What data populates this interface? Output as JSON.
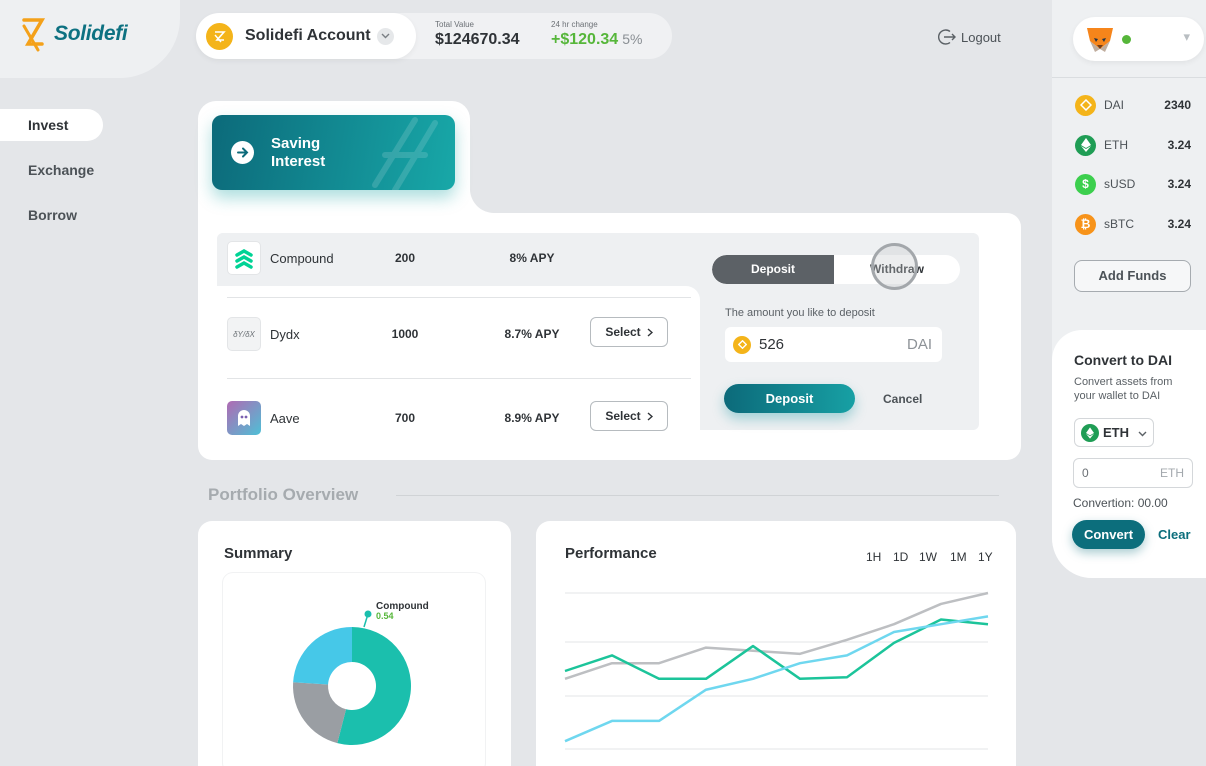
{
  "brand": {
    "name": "Solidefi"
  },
  "nav": {
    "items": [
      {
        "label": "Invest",
        "active": true
      },
      {
        "label": "Exchange",
        "active": false
      },
      {
        "label": "Borrow",
        "active": false
      }
    ]
  },
  "header": {
    "account_name": "Solidefi Account",
    "total_value_label": "Total Value",
    "total_value": "$124670.34",
    "change_label": "24 hr change",
    "change_value": "+$120.34",
    "change_pct": "5%",
    "logout_label": "Logout"
  },
  "wallet": {
    "icon": "metamask-fox-icon",
    "status_color": "#56b63a",
    "tokens": [
      {
        "name": "DAI",
        "value": "2340",
        "icon": "dai-icon",
        "color": "#f4b41a"
      },
      {
        "name": "ETH",
        "value": "3.24",
        "icon": "eth-icon",
        "color": "#1f9d55"
      },
      {
        "name": "sUSD",
        "value": "3.24",
        "icon": "susd-icon",
        "color": "#3ccf4e"
      },
      {
        "name": "sBTC",
        "value": "3.24",
        "icon": "sbtc-icon",
        "color": "#f7931a"
      }
    ],
    "add_funds_label": "Add Funds"
  },
  "convert": {
    "title": "Convert to DAI",
    "description": "Convert assets from your wallet to DAI",
    "asset": "ETH",
    "amount": "0",
    "amount_unit": "ETH",
    "result": "Convertion: 00.00",
    "convert_label": "Convert",
    "clear_label": "Clear"
  },
  "invest": {
    "tab_label": "Saving Interest",
    "protocols": [
      {
        "name": "Compound",
        "amount": "200",
        "apy": "8% APY",
        "selected": true,
        "select_label": ""
      },
      {
        "name": "Dydx",
        "amount": "1000",
        "apy": "8.7% APY",
        "selected": false,
        "select_label": "Select"
      },
      {
        "name": "Aave",
        "amount": "700",
        "apy": "8.9% APY",
        "selected": false,
        "select_label": "Select"
      }
    ],
    "dydx_logo_text": "δY/δX",
    "deposit_tab": "Deposit",
    "withdraw_tab": "Withdraw",
    "amount_label": "The amount you like to deposit",
    "amount_value": "526",
    "amount_unit": "DAI",
    "deposit_button": "Deposit",
    "cancel_button": "Cancel"
  },
  "portfolio": {
    "title": "Portfolio Overview",
    "summary_title": "Summary",
    "performance_title": "Performance",
    "ranges": [
      "1H",
      "1D",
      "1W",
      "1M",
      "1Y"
    ]
  },
  "chart_data": [
    {
      "type": "pie",
      "title": "Summary",
      "donut": true,
      "slices": [
        {
          "label": "Compound",
          "value": 0.54,
          "color": "#1bbfad"
        },
        {
          "label": "",
          "value": 0.22,
          "color": "#9a9ea3"
        },
        {
          "label": "",
          "value": 0.24,
          "color": "#46c8e8"
        }
      ],
      "callout": {
        "label": "Compound",
        "value": "0.54",
        "color": "#56b63a"
      }
    },
    {
      "type": "line",
      "title": "Performance",
      "x": [
        0,
        1,
        2,
        3,
        4,
        5,
        6,
        7,
        8,
        9
      ],
      "ylim": [
        0,
        100
      ],
      "grid": true,
      "series": [
        {
          "name": "",
          "color": "#bdbfc2",
          "values": [
            45,
            55,
            55,
            65,
            63,
            61,
            70,
            80,
            93,
            100
          ]
        },
        {
          "name": "",
          "color": "#1cc49a",
          "values": [
            50,
            60,
            45,
            45,
            66,
            45,
            46,
            68,
            83,
            80
          ]
        },
        {
          "name": "",
          "color": "#6fd7ef",
          "values": [
            5,
            18,
            18,
            38,
            45,
            55,
            60,
            75,
            80,
            85
          ]
        }
      ]
    }
  ]
}
